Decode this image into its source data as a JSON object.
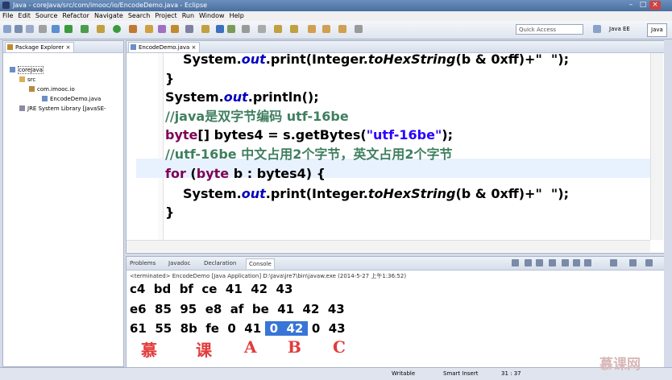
{
  "window": {
    "title": "Java - coreJava/src/com/imooc/io/EncodeDemo.java - Eclipse"
  },
  "menu": [
    "File",
    "Edit",
    "Source",
    "Refactor",
    "Navigate",
    "Search",
    "Project",
    "Run",
    "Window",
    "Help"
  ],
  "toolbar": {
    "quick_access_placeholder": "Quick Access",
    "perspective_ee": "Java EE",
    "perspective_java": "Java"
  },
  "package_explorer": {
    "title": "Package Explorer",
    "items": [
      "coreJava",
      "src",
      "com.imooc.io",
      "EncodeDemo.java",
      "JRE System Library [JavaSE-"
    ]
  },
  "editor": {
    "tab": "EncodeDemo.java",
    "lines": {
      "l1_a": "System.",
      "l1_b": "out",
      "l1_c": ".print(Integer.",
      "l1_d": "toHexString",
      "l1_e": "(b & 0xff)+\"  \");",
      "l2": "}",
      "l3_a": "System.",
      "l3_b": "out",
      "l3_c": ".println();",
      "l4": "//java是双字节编码 utf-16be",
      "l5_a": "byte",
      "l5_b": "[] bytes4 = s.getBytes(",
      "l5_c": "\"utf-16be\"",
      "l5_d": ");",
      "l6": "//utf-16be 中文占用2个字节，英文占用2个字节",
      "l7_a": "for",
      "l7_b": " (",
      "l7_c": "byte",
      "l7_d": " b : bytes4) {",
      "l8_a": "System.",
      "l8_b": "out",
      "l8_c": ".print(Integer.",
      "l8_d": "toHexString",
      "l8_e": "(b & 0xff)+\"  \");",
      "l9": "}"
    }
  },
  "console": {
    "tabs": [
      "Problems",
      "Javadoc",
      "Declaration",
      "Console"
    ],
    "terminated": "<terminated> EncodeDemo [Java Application] D:\\Java\\jre7\\bin\\javaw.exe (2014-5-27 上午1:36:52)",
    "out1": "c4  bd  bf  ce  41  42  43",
    "out2": "e6  85  95  e8  af  be  41  42  43",
    "out3_a": "61  55  8b  fe  0  41 ",
    "out3_sel": " 0  42 ",
    "out3_b": " 0  43",
    "annotations": [
      "慕",
      "课",
      "A",
      "B",
      "C"
    ]
  },
  "status": {
    "writable": "Writable",
    "insert": "Smart Insert",
    "position": "31 : 37"
  },
  "watermark": "慕课网"
}
